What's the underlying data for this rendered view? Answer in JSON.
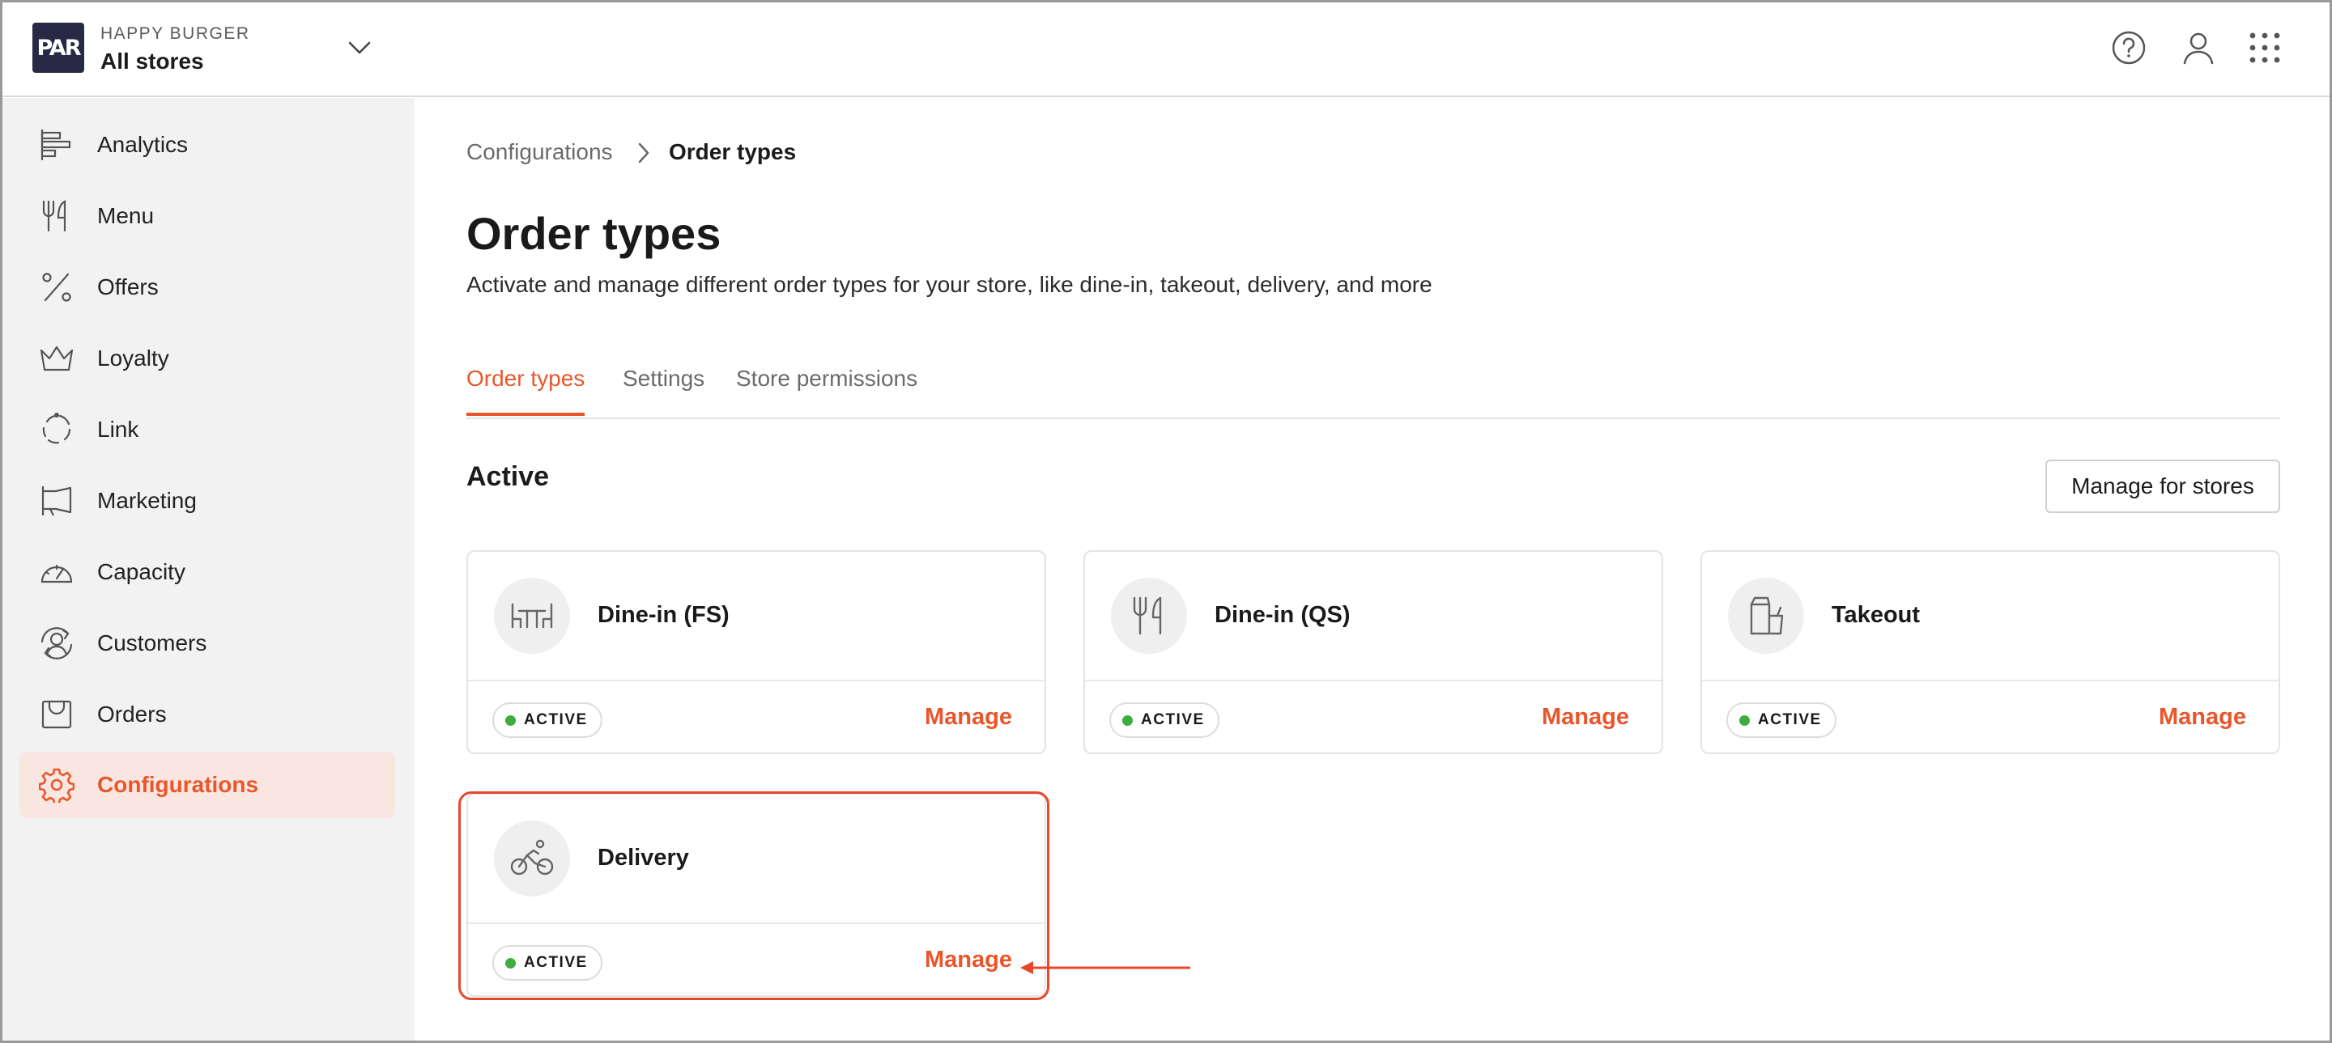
{
  "header": {
    "brand": "HAPPY BURGER",
    "store": "All stores",
    "logo_text": "PAR"
  },
  "sidebar": {
    "items": [
      {
        "label": "Analytics",
        "icon": "analytics-icon"
      },
      {
        "label": "Menu",
        "icon": "fork-knife-icon"
      },
      {
        "label": "Offers",
        "icon": "percent-icon"
      },
      {
        "label": "Loyalty",
        "icon": "crown-icon"
      },
      {
        "label": "Link",
        "icon": "link-circle-icon"
      },
      {
        "label": "Marketing",
        "icon": "megaphone-icon"
      },
      {
        "label": "Capacity",
        "icon": "gauge-icon"
      },
      {
        "label": "Customers",
        "icon": "customers-icon"
      },
      {
        "label": "Orders",
        "icon": "orders-icon"
      },
      {
        "label": "Configurations",
        "icon": "gear-icon",
        "active": true
      }
    ]
  },
  "breadcrumb": {
    "parent": "Configurations",
    "current": "Order types"
  },
  "page": {
    "title": "Order types",
    "subtitle": "Activate and manage different order types for your store, like dine-in, takeout, delivery, and more"
  },
  "tabs": [
    {
      "label": "Order types",
      "active": true
    },
    {
      "label": "Settings",
      "active": false
    },
    {
      "label": "Store permissions",
      "active": false
    }
  ],
  "section": {
    "title": "Active",
    "button_label": "Manage for stores"
  },
  "order_types": [
    {
      "name": "Dine-in (FS)",
      "status": "ACTIVE",
      "action": "Manage",
      "icon": "table-icon"
    },
    {
      "name": "Dine-in (QS)",
      "status": "ACTIVE",
      "action": "Manage",
      "icon": "fork-knife-icon"
    },
    {
      "name": "Takeout",
      "status": "ACTIVE",
      "action": "Manage",
      "icon": "takeout-bag-icon"
    },
    {
      "name": "Delivery",
      "status": "ACTIVE",
      "action": "Manage",
      "icon": "bicycle-icon"
    }
  ],
  "colors": {
    "accent": "#e8572c",
    "active_dot": "#3dad3d",
    "logo_bg": "#262a44",
    "sidebar_bg": "#f2f2f2",
    "highlight": "#e8472c"
  }
}
